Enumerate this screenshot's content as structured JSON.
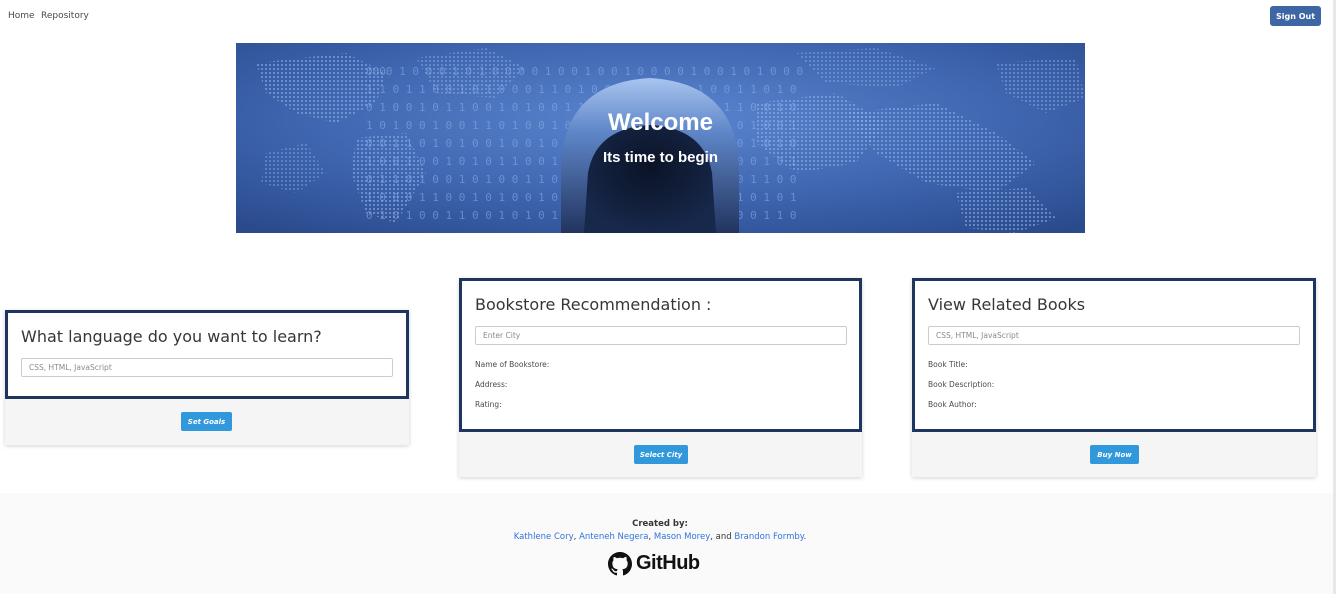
{
  "nav": {
    "home": "Home",
    "repository": "Repository",
    "sign_out": "Sign Out"
  },
  "hero": {
    "title": "Welcome",
    "subtitle": "Its time to begin"
  },
  "cards": {
    "language": {
      "title": "What language do you want to learn?",
      "input_placeholder": "CSS, HTML, JavaScript",
      "button": "Set Goals"
    },
    "bookstore": {
      "title": "Bookstore Recommendation :",
      "input_placeholder": "Enter City",
      "fields": [
        "Name of Bookstore:",
        "Address:",
        "Rating:"
      ],
      "button": "Select City"
    },
    "related": {
      "title": "View Related Books",
      "input_placeholder": "CSS, HTML, JavaScript",
      "fields": [
        "Book Title:",
        "Book Description:",
        "Book Author:"
      ],
      "button": "Buy Now"
    }
  },
  "footer": {
    "created_by": "Created by:",
    "authors": [
      "Kathlene Cory",
      "Anteneh Negera",
      "Mason Morey",
      "Brandon Formby"
    ],
    "sep1": ", ",
    "sep2": ", ",
    "sep3": ", and ",
    "end": ".",
    "github": "GitHub"
  },
  "colors": {
    "primary_button": "#3298dc",
    "sign_out": "#3e66a5",
    "card_border": "#1e3560",
    "link": "#3273dc"
  }
}
